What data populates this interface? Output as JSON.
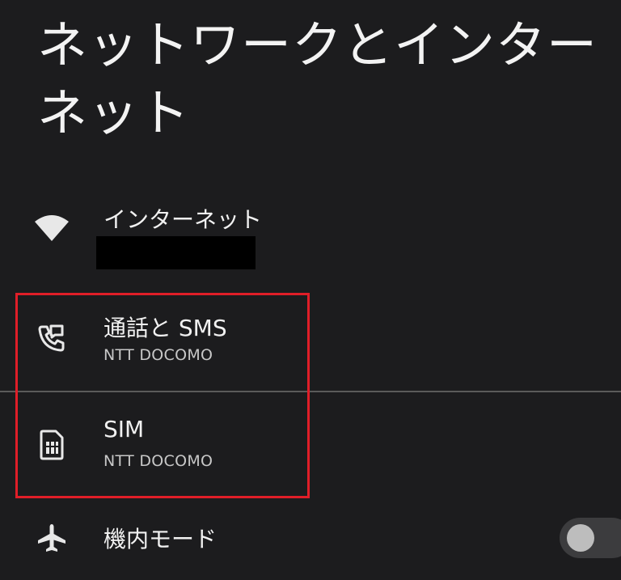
{
  "header": {
    "title_line1": "ネットワークとインター",
    "title_line2": "ネット"
  },
  "items": [
    {
      "id": "internet",
      "title": "インターネット",
      "subtitle": "",
      "icon": "wifi-icon"
    },
    {
      "id": "calls-sms",
      "title": "通話と SMS",
      "subtitle": "NTT DOCOMO",
      "icon": "call-sms-icon"
    },
    {
      "id": "sim",
      "title": "SIM",
      "subtitle": "NTT DOCOMO",
      "icon": "sim-card-icon"
    },
    {
      "id": "airplane",
      "title": "機内モード",
      "icon": "airplane-icon",
      "toggle_on": false
    }
  ],
  "colors": {
    "background": "#1c1c1e",
    "highlight": "#e01e28"
  }
}
